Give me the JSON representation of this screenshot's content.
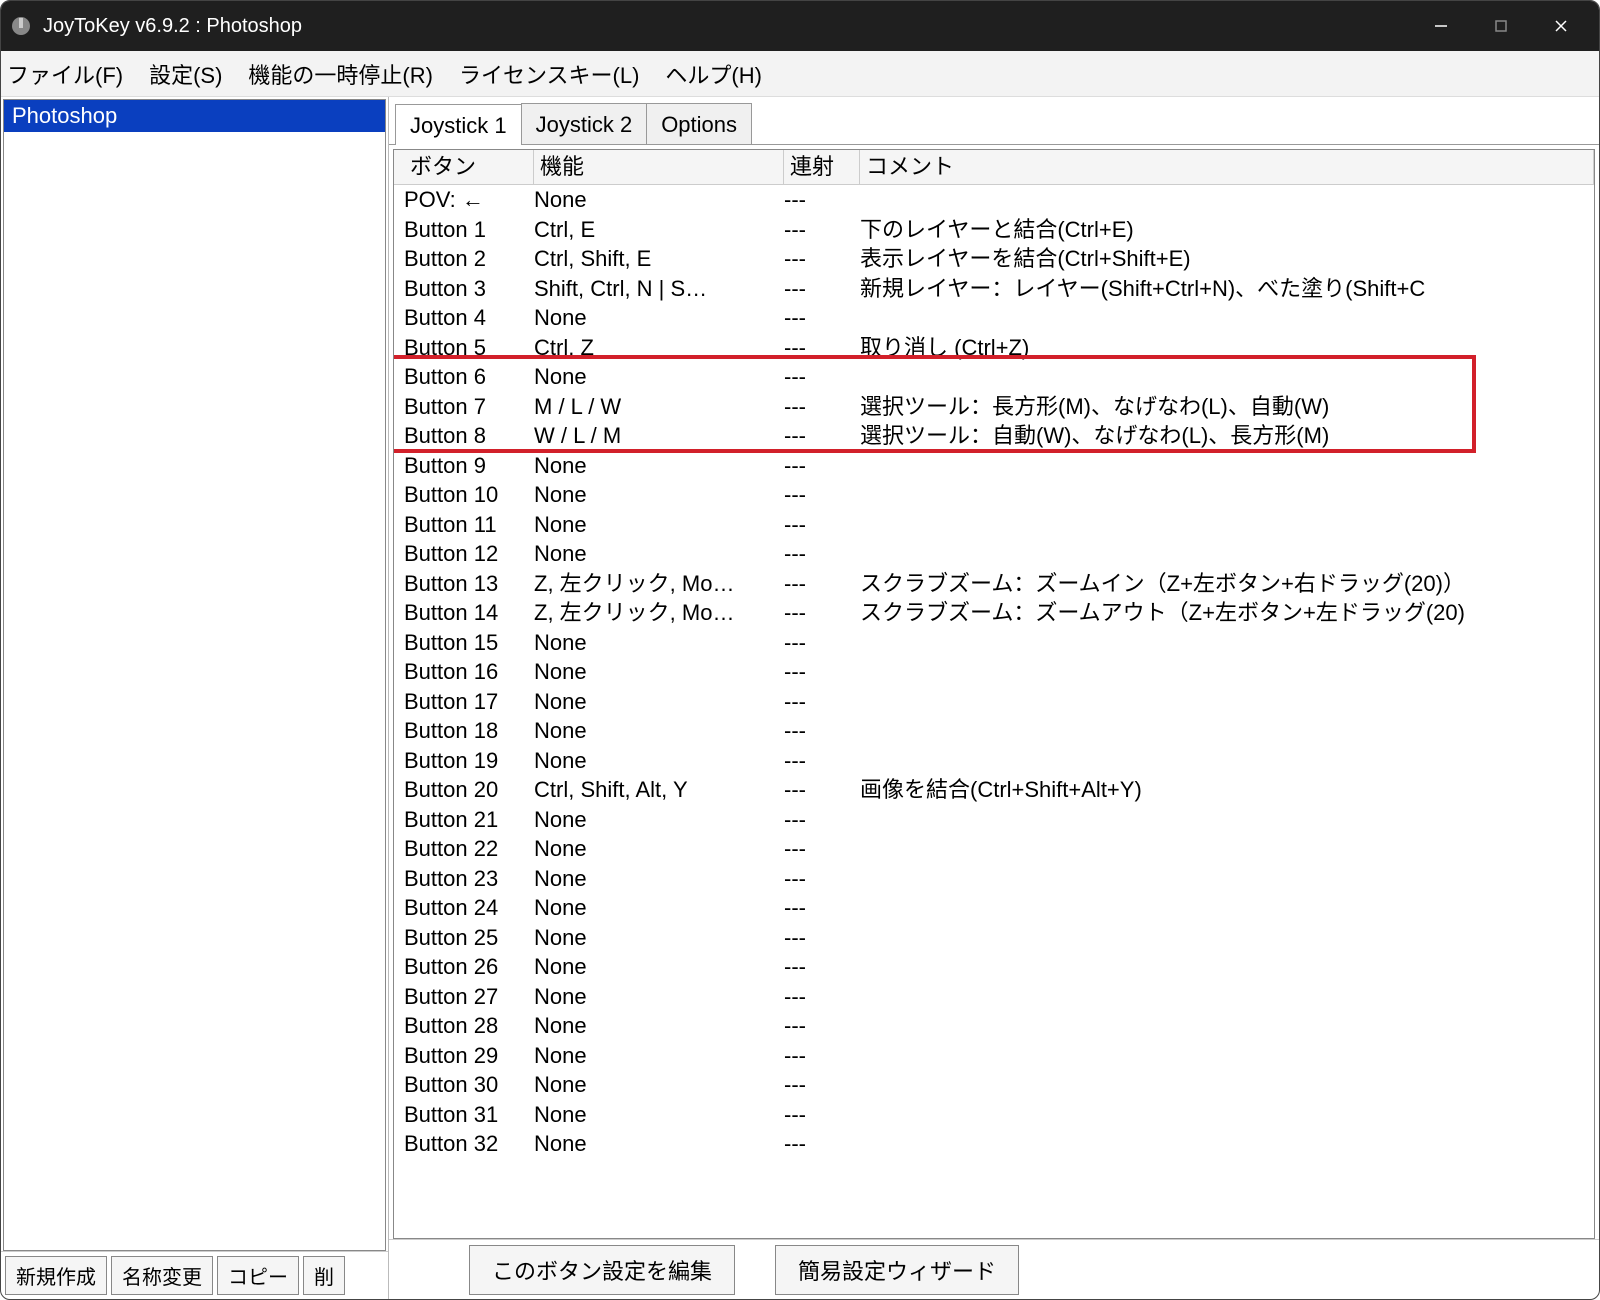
{
  "window": {
    "title": "JoyToKey v6.9.2 : Photoshop"
  },
  "menu": {
    "file": "ファイル(F)",
    "settings": "設定(S)",
    "pause": "機能の一時停止(R)",
    "license": "ライセンスキー(L)",
    "help": "ヘルプ(H)"
  },
  "sidebar": {
    "profile": "Photoshop",
    "new": "新規作成",
    "rename": "名称変更",
    "copy": "コピー",
    "delete": "削"
  },
  "tabs": {
    "joy1": "Joystick 1",
    "joy2": "Joystick 2",
    "options": "Options"
  },
  "headers": {
    "button": "ボタン",
    "func": "機能",
    "rapid": "連射",
    "comment": "コメント"
  },
  "rows": [
    {
      "b": "POV: ←",
      "f": "None",
      "r": "---",
      "c": ""
    },
    {
      "b": "Button 1",
      "f": "Ctrl, E",
      "r": "---",
      "c": "下のレイヤーと結合(Ctrl+E)"
    },
    {
      "b": "Button 2",
      "f": "Ctrl, Shift, E",
      "r": "---",
      "c": "表示レイヤーを結合(Ctrl+Shift+E)"
    },
    {
      "b": "Button 3",
      "f": "Shift, Ctrl, N | S…",
      "r": "---",
      "c": "新規レイヤー：レイヤー(Shift+Ctrl+N)、べた塗り(Shift+C"
    },
    {
      "b": "Button 4",
      "f": "None",
      "r": "---",
      "c": ""
    },
    {
      "b": "Button 5",
      "f": "Ctrl, Z",
      "r": "---",
      "c": "取り消し (Ctrl+Z)"
    },
    {
      "b": "Button 6",
      "f": "None",
      "r": "---",
      "c": ""
    },
    {
      "b": "Button 7",
      "f": "M / L / W",
      "r": "---",
      "c": "選択ツール：長方形(M)、なげなわ(L)、自動(W)"
    },
    {
      "b": "Button 8",
      "f": "W / L / M",
      "r": "---",
      "c": "選択ツール：自動(W)、なげなわ(L)、長方形(M)"
    },
    {
      "b": "Button 9",
      "f": "None",
      "r": "---",
      "c": ""
    },
    {
      "b": "Button 10",
      "f": "None",
      "r": "---",
      "c": ""
    },
    {
      "b": "Button 11",
      "f": "None",
      "r": "---",
      "c": ""
    },
    {
      "b": "Button 12",
      "f": "None",
      "r": "---",
      "c": ""
    },
    {
      "b": "Button 13",
      "f": "Z, 左クリック, Mo…",
      "r": "---",
      "c": "スクラブズーム：ズームイン（Z+左ボタン+右ドラッグ(20)）"
    },
    {
      "b": "Button 14",
      "f": "Z, 左クリック, Mo…",
      "r": "---",
      "c": "スクラブズーム：ズームアウト（Z+左ボタン+左ドラッグ(20)"
    },
    {
      "b": "Button 15",
      "f": "None",
      "r": "---",
      "c": ""
    },
    {
      "b": "Button 16",
      "f": "None",
      "r": "---",
      "c": ""
    },
    {
      "b": "Button 17",
      "f": "None",
      "r": "---",
      "c": ""
    },
    {
      "b": "Button 18",
      "f": "None",
      "r": "---",
      "c": ""
    },
    {
      "b": "Button 19",
      "f": "None",
      "r": "---",
      "c": ""
    },
    {
      "b": "Button 20",
      "f": "Ctrl, Shift, Alt, Y",
      "r": "---",
      "c": "画像を結合(Ctrl+Shift+Alt+Y)"
    },
    {
      "b": "Button 21",
      "f": "None",
      "r": "---",
      "c": ""
    },
    {
      "b": "Button 22",
      "f": "None",
      "r": "---",
      "c": ""
    },
    {
      "b": "Button 23",
      "f": "None",
      "r": "---",
      "c": ""
    },
    {
      "b": "Button 24",
      "f": "None",
      "r": "---",
      "c": ""
    },
    {
      "b": "Button 25",
      "f": "None",
      "r": "---",
      "c": ""
    },
    {
      "b": "Button 26",
      "f": "None",
      "r": "---",
      "c": ""
    },
    {
      "b": "Button 27",
      "f": "None",
      "r": "---",
      "c": ""
    },
    {
      "b": "Button 28",
      "f": "None",
      "r": "---",
      "c": ""
    },
    {
      "b": "Button 29",
      "f": "None",
      "r": "---",
      "c": ""
    },
    {
      "b": "Button 30",
      "f": "None",
      "r": "---",
      "c": ""
    },
    {
      "b": "Button 31",
      "f": "None",
      "r": "---",
      "c": ""
    },
    {
      "b": "Button 32",
      "f": "None",
      "r": "---",
      "c": ""
    }
  ],
  "bottom": {
    "edit": "このボタン設定を編集",
    "wizard": "簡易設定ウィザード"
  },
  "highlight": {
    "top_row_index": 6,
    "row_span": 4
  }
}
